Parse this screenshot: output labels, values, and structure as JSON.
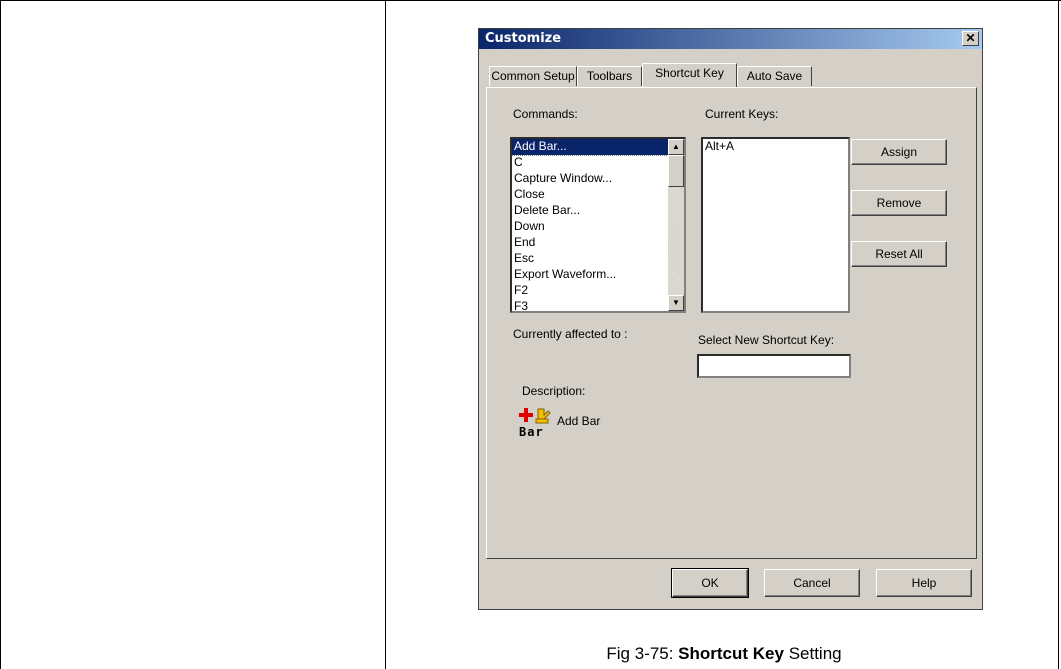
{
  "dialog": {
    "title": "Customize",
    "close_symbol": "✕",
    "tabs": [
      {
        "label": "Common Setup"
      },
      {
        "label": "Toolbars"
      },
      {
        "label": "Shortcut Key",
        "active": true
      },
      {
        "label": "Auto Save"
      }
    ],
    "commands_label": "Commands:",
    "current_keys_label": "Current Keys:",
    "commands": [
      {
        "label": "Add Bar...",
        "selected": true
      },
      {
        "label": "C"
      },
      {
        "label": "Capture Window..."
      },
      {
        "label": "Close"
      },
      {
        "label": "Delete Bar..."
      },
      {
        "label": "Down"
      },
      {
        "label": "End"
      },
      {
        "label": "Esc"
      },
      {
        "label": "Export Waveform..."
      },
      {
        "label": "F2"
      },
      {
        "label": "F3"
      }
    ],
    "current_keys": [
      "Alt+A"
    ],
    "buttons": {
      "assign": "Assign",
      "remove": "Remove",
      "reset_all": "Reset All",
      "ok": "OK",
      "cancel": "Cancel",
      "help": "Help"
    },
    "currently_affected_label": "Currently affected to :",
    "select_new_label": "Select New Shortcut Key:",
    "new_shortcut_value": "",
    "description_label": "Description:",
    "description_icon": "add-bar-icon",
    "description_icon_text": "Bar",
    "description_text": "Add Bar"
  },
  "caption": {
    "prefix": "Fig 3-75: ",
    "bold": "Shortcut Key",
    "suffix": " Setting"
  }
}
